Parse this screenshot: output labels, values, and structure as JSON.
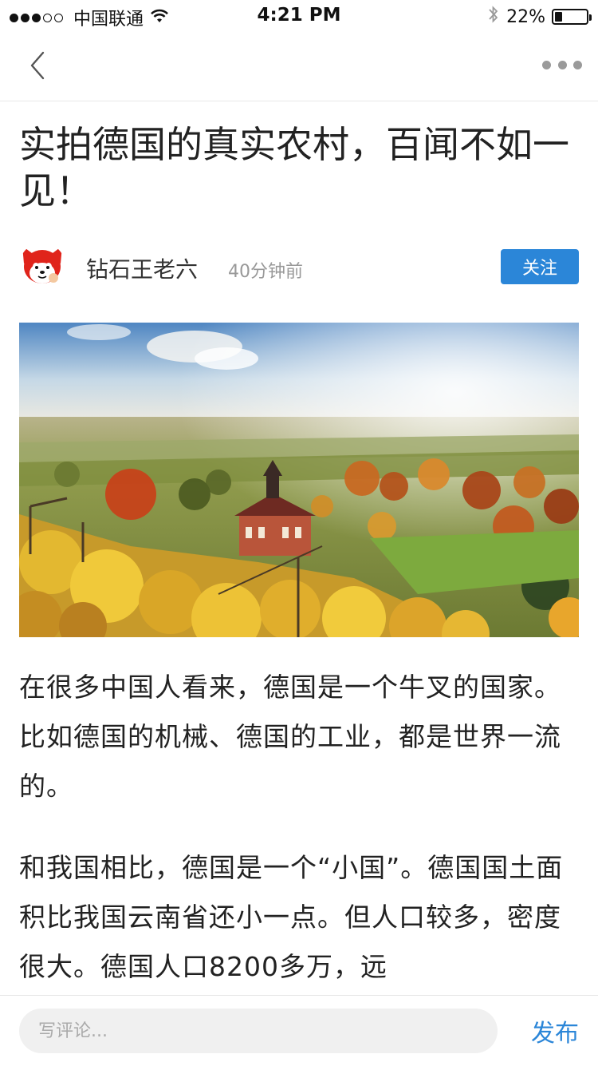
{
  "status_bar": {
    "signal_bars_filled": 3,
    "signal_bars_total": 5,
    "carrier": "中国联通",
    "time": "4:21 PM",
    "battery_percent": "22%",
    "battery_level": 0.22,
    "icons": [
      "signal-dots",
      "wifi-icon",
      "bluetooth-icon",
      "battery-icon"
    ]
  },
  "nav": {
    "back_icon": "chevron-left-icon",
    "more_icon": "more-horizontal-icon"
  },
  "article": {
    "title": "实拍德国的真实农村，百闻不如一见！",
    "author": {
      "name": "钻石王老六",
      "time": "40分钟前",
      "follow_label": "关注"
    },
    "paragraphs": [
      "在很多中国人看来，德国是一个牛叉的国家。比如德国的机械、德国的工业，都是世界一流的。",
      "和我国相比，德国是一个“小国”。德国国土面积比我国云南省还小一点。但人口较多，密度很大。德国人口8200多万，远"
    ]
  },
  "comment_bar": {
    "placeholder": "写评论...",
    "publish_label": "发布"
  },
  "colors": {
    "accent": "#2b86d8",
    "text": "#222222",
    "muted": "#999999"
  }
}
